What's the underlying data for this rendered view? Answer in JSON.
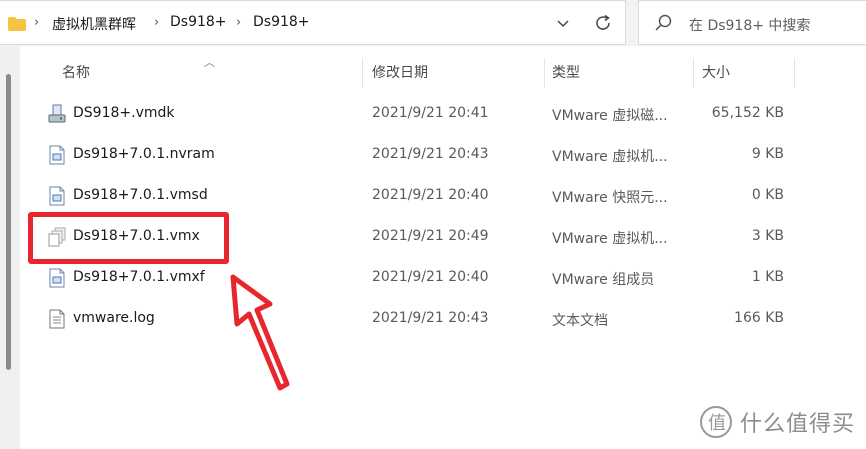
{
  "address": {
    "crumbs": [
      "虚拟机黑群晖",
      "Ds918+",
      "Ds918+"
    ],
    "separator": "›"
  },
  "search": {
    "placeholder": "在 Ds918+ 中搜索"
  },
  "columns": {
    "name": "名称",
    "modified": "修改日期",
    "type": "类型",
    "size": "大小"
  },
  "files": [
    {
      "name": "DS918+.vmdk",
      "modified": "2021/9/21 20:41",
      "type": "VMware 虚拟磁...",
      "size": "65,152 KB",
      "icon": "disk-icon"
    },
    {
      "name": "Ds918+7.0.1.nvram",
      "modified": "2021/9/21 20:43",
      "type": "VMware 虚拟机...",
      "size": "9 KB",
      "icon": "vmware-file-icon"
    },
    {
      "name": "Ds918+7.0.1.vmsd",
      "modified": "2021/9/21 20:40",
      "type": "VMware 快照元...",
      "size": "0 KB",
      "icon": "vmware-file-icon"
    },
    {
      "name": "Ds918+7.0.1.vmx",
      "modified": "2021/9/21 20:49",
      "type": "VMware 虚拟机...",
      "size": "3 KB",
      "icon": "vmx-icon"
    },
    {
      "name": "Ds918+7.0.1.vmxf",
      "modified": "2021/9/21 20:40",
      "type": "VMware 组成员",
      "size": "1 KB",
      "icon": "vmware-file-icon"
    },
    {
      "name": "vmware.log",
      "modified": "2021/9/21 20:43",
      "type": "文本文档",
      "size": "166 KB",
      "icon": "text-file-icon"
    }
  ],
  "watermark": {
    "text": "什么值得买"
  },
  "colors": {
    "highlight": "#e8262e",
    "folder": "#f5c342"
  }
}
